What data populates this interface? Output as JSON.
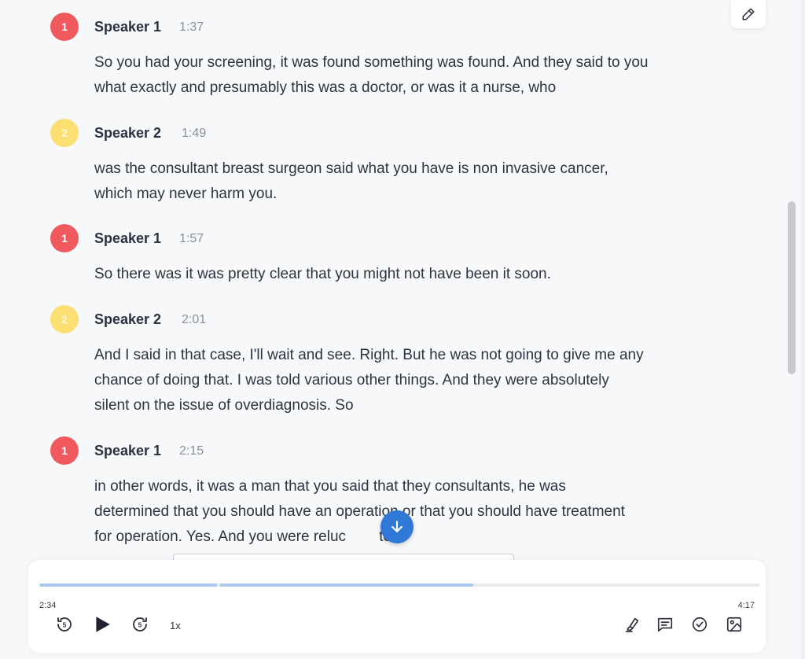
{
  "transcript": {
    "entries": [
      {
        "number": "1",
        "speaker": "Speaker 1",
        "time": "1:37",
        "lines": [
          "So you had your screening, it was found something was found. And they said to you",
          "what exactly and presumably this was a doctor, or was it a nurse, who"
        ]
      },
      {
        "number": "2",
        "speaker": "Speaker 2",
        "time": "1:49",
        "lines": [
          "was the consultant breast surgeon said what you have is non invasive cancer,",
          "which may never harm you."
        ]
      },
      {
        "number": "1",
        "speaker": "Speaker 1",
        "time": "1:57",
        "lines": [
          "So there was it was pretty clear that you might not have been it soon."
        ]
      },
      {
        "number": "2",
        "speaker": "Speaker 2",
        "time": "2:01",
        "lines": [
          "And I said in that case, I'll wait and see. Right. But he was not going to give me any",
          "chance of doing that. I was told various other things. And they were absolutely",
          "silent on the issue of overdiagnosis. So"
        ]
      },
      {
        "number": "1",
        "speaker": "Speaker 1",
        "time": "2:15",
        "lines": [
          "in other words, it was a man that you said that they consultants, he was",
          "determined that you should have an operation or that you should have treatment",
          "for operation. Yes. And you were reluc        to?"
        ]
      }
    ]
  },
  "player": {
    "current_time": "2:34",
    "duration": "4:17",
    "speed": "1x",
    "rewind_seconds": "5",
    "forward_seconds": "5"
  },
  "icons": {
    "edit": "pencil-icon",
    "jump": "arrow-down-icon",
    "rewind": "rewind-5-icon",
    "play": "play-icon",
    "forward": "forward-5-icon",
    "highlight": "highlighter-icon",
    "comment": "comment-icon",
    "check": "check-circle-icon",
    "image": "image-icon"
  },
  "colors": {
    "speaker1": "#f05a5f",
    "speaker2": "#fbdf73",
    "accent": "#2f78d6",
    "progress": "#a9c8f0"
  }
}
